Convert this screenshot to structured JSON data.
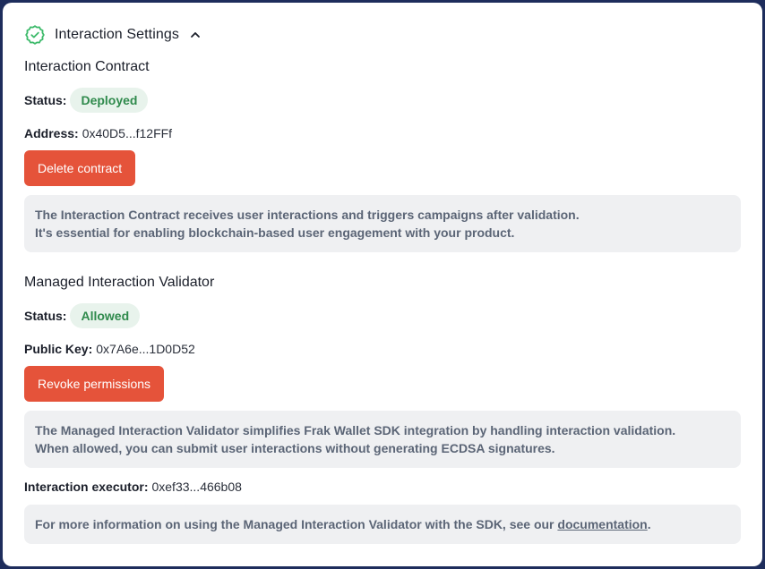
{
  "colors": {
    "accent_button": "#e5533a",
    "badge_bg": "#e8f3ec",
    "badge_text": "#2f8a4c",
    "check_icon": "#3cba6a",
    "info_bg": "#eff0f2"
  },
  "header": {
    "icon": "check-badge-icon",
    "title": "Interaction Settings",
    "toggle_icon": "chevron-up-icon"
  },
  "contract": {
    "title": "Interaction Contract",
    "status_label": "Status:",
    "status_value": "Deployed",
    "address_label": "Address:",
    "address_value": "0x40D5...f12FFf",
    "button_label": "Delete contract",
    "info_line1": "The Interaction Contract receives user interactions and triggers campaigns after validation.",
    "info_line2": "It's essential for enabling blockchain-based user engagement with your product."
  },
  "validator": {
    "title": "Managed Interaction Validator",
    "status_label": "Status:",
    "status_value": "Allowed",
    "pubkey_label": "Public Key:",
    "pubkey_value": "0x7A6e...1D0D52",
    "button_label": "Revoke permissions",
    "info_line1": "The Managed Interaction Validator simplifies Frak Wallet SDK integration by handling interaction validation.",
    "info_line2": "When allowed, you can submit user interactions without generating ECDSA signatures."
  },
  "executor": {
    "label": "Interaction executor:",
    "value": "0xef33...466b08"
  },
  "footer_info": {
    "text": "For more information on using the Managed Interaction Validator with the SDK, see our ",
    "link_text": "documentation",
    "suffix": "."
  }
}
